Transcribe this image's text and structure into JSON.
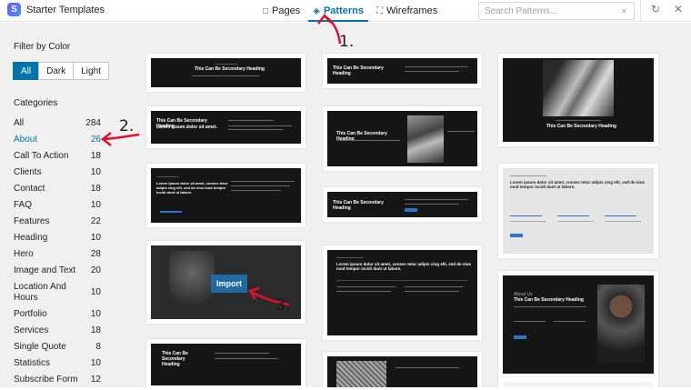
{
  "header": {
    "app_name": "Starter Templates",
    "logo_letter": "S",
    "tabs": [
      {
        "label": "Pages",
        "icon": "page-icon"
      },
      {
        "label": "Patterns",
        "icon": "layers-icon"
      },
      {
        "label": "Wireframes",
        "icon": "wireframe-icon"
      }
    ],
    "search_placeholder": "Search Patterns..."
  },
  "sidebar": {
    "filter_title": "Filter by Color",
    "color_options": [
      "All",
      "Dark",
      "Light"
    ],
    "categories_title": "Categories",
    "categories": [
      {
        "name": "All",
        "count": "284"
      },
      {
        "name": "About",
        "count": "26"
      },
      {
        "name": "Call To Action",
        "count": "18"
      },
      {
        "name": "Clients",
        "count": "10"
      },
      {
        "name": "Contact",
        "count": "18"
      },
      {
        "name": "FAQ",
        "count": "10"
      },
      {
        "name": "Features",
        "count": "22"
      },
      {
        "name": "Heading",
        "count": "10"
      },
      {
        "name": "Hero",
        "count": "28"
      },
      {
        "name": "Image and Text",
        "count": "20"
      },
      {
        "name": "Location And Hours",
        "count": "10"
      },
      {
        "name": "Portfolio",
        "count": "10"
      },
      {
        "name": "Services",
        "count": "18"
      },
      {
        "name": "Single Quote",
        "count": "8"
      },
      {
        "name": "Statistics",
        "count": "10"
      },
      {
        "name": "Subscribe Form",
        "count": "12"
      }
    ]
  },
  "cards": {
    "secondary_heading": "This Can Be Secondary Heading",
    "lorem_short": "Lorem ipsum dolor sit amet.",
    "lorem_long": "Lorem ipsum dolor sit amet, consec tetur adipis cing elit, sed do eius mod tempor incidi dunt ut labore.",
    "about_us": "About Us",
    "import_label": "Import"
  },
  "annotations": [
    "1.",
    "2.",
    "3."
  ],
  "colors": {
    "accent": "#0073aa",
    "arrow": "#e0102a"
  }
}
